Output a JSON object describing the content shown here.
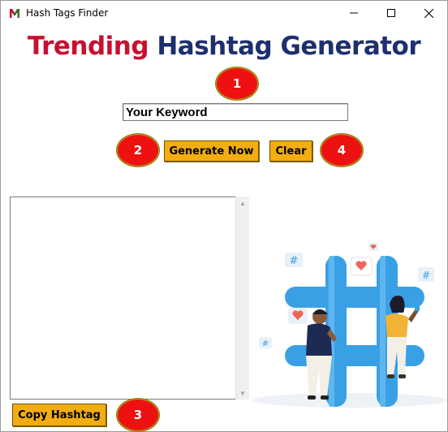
{
  "window": {
    "title": "Hash Tags Finder",
    "icon": "app-logo-icon",
    "controls": [
      "minimize-icon",
      "maximize-icon",
      "close-icon"
    ]
  },
  "heading": {
    "word1": "Trending",
    "word2": "Hashtag Generator"
  },
  "keyword_input": {
    "value": "Your Keyword"
  },
  "buttons": {
    "generate": "Generate Now",
    "clear": "Clear",
    "copy": "Copy Hashtag"
  },
  "markers": {
    "m1": "1",
    "m2": "2",
    "m3": "3",
    "m4": "4"
  },
  "output": {
    "value": ""
  },
  "colors": {
    "accent_red": "#c8102e",
    "accent_navy": "#1d2f6f",
    "button": "#f2ad12",
    "marker": "#ee1111",
    "hashtag": "#3aa0e6"
  }
}
